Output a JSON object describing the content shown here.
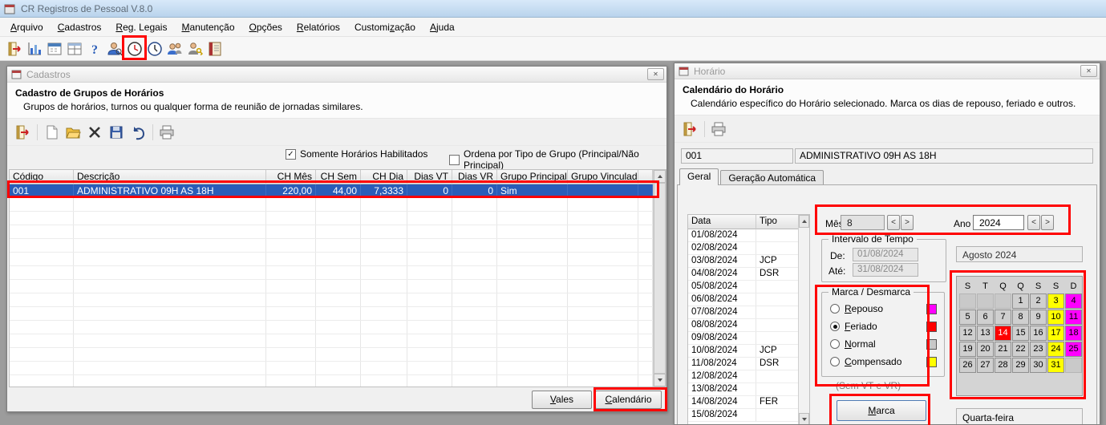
{
  "app": {
    "title": "CR Registros de Pessoal V.8.0"
  },
  "menu": {
    "items": [
      {
        "label": "Arquivo",
        "u": 0
      },
      {
        "label": "Cadastros",
        "u": 0
      },
      {
        "label": "Reg. Legais",
        "u": 0
      },
      {
        "label": "Manutenção",
        "u": 0
      },
      {
        "label": "Opções",
        "u": 0
      },
      {
        "label": "Relatórios",
        "u": 0
      },
      {
        "label": "Customização",
        "u": 7
      },
      {
        "label": "Ajuda",
        "u": 0
      }
    ]
  },
  "main_toolbar": {
    "icons": [
      "exit",
      "chart",
      "calendar",
      "grid",
      "help",
      "user-search",
      "clock-circle",
      "clock",
      "users",
      "user-key",
      "ledger"
    ]
  },
  "cadastros_window": {
    "title": "Cadastros",
    "header": {
      "title": "Cadastro de Grupos de Horários",
      "subtitle": "Grupos de horários, turnos ou qualquer forma de reunião de jornadas similares."
    },
    "toolbar_icons": [
      "exit",
      "sep",
      "new",
      "open",
      "delete",
      "save",
      "undo",
      "sep",
      "print"
    ],
    "checkboxes": [
      {
        "label": "Somente Horários Habilitados",
        "checked": true
      },
      {
        "label": "Ordena por Tipo de Grupo (Principal/Não Principal)",
        "checked": false
      }
    ],
    "grid": {
      "columns": [
        "Código",
        "Descrição",
        "CH Mês",
        "CH Sem",
        "CH Dia",
        "Dias VT",
        "Dias VR",
        "Grupo Principal",
        "Grupo Vinculado"
      ],
      "rows": [
        [
          "001",
          "ADMINISTRATIVO 09H AS 18H",
          "220,00",
          "44,00",
          "7,3333",
          "0",
          "0",
          "Sim",
          ""
        ]
      ],
      "selected_row": 0,
      "empty_rows": 15
    },
    "buttons": [
      {
        "label": "Vales",
        "u": 0
      },
      {
        "label": "Calendário",
        "u": 0
      }
    ]
  },
  "horario_window": {
    "title": "Horário",
    "header": {
      "title": "Calendário do Horário",
      "subtitle": "Calendário específico do Horário selecionado. Marca os dias de repouso, feriado e outros."
    },
    "toolbar_icons": [
      "exit",
      "sep",
      "print"
    ],
    "code_value": "001",
    "name_value": "ADMINISTRATIVO 09H AS 18H",
    "tabs": [
      {
        "label": "Geral",
        "active": true
      },
      {
        "label": "Geração Automática",
        "active": false
      }
    ],
    "date_grid": {
      "columns": [
        "Data",
        "Tipo"
      ],
      "rows": [
        [
          "01/08/2024",
          ""
        ],
        [
          "02/08/2024",
          ""
        ],
        [
          "03/08/2024",
          "JCP"
        ],
        [
          "04/08/2024",
          "DSR"
        ],
        [
          "05/08/2024",
          ""
        ],
        [
          "06/08/2024",
          ""
        ],
        [
          "07/08/2024",
          ""
        ],
        [
          "08/08/2024",
          ""
        ],
        [
          "09/08/2024",
          ""
        ],
        [
          "10/08/2024",
          "JCP"
        ],
        [
          "11/08/2024",
          "DSR"
        ],
        [
          "12/08/2024",
          ""
        ],
        [
          "13/08/2024",
          ""
        ],
        [
          "14/08/2024",
          "FER"
        ],
        [
          "15/08/2024",
          ""
        ]
      ]
    },
    "month_year": {
      "mes_label": "Mês",
      "mes_value": "8",
      "ano_label": "Ano",
      "ano_value": "2024",
      "prev": "<",
      "next": ">"
    },
    "intervalo": {
      "legend": "Intervalo de Tempo",
      "de_label": "De:",
      "de_value": "01/08/2024",
      "ate_label": "Até:",
      "ate_value": "31/08/2024"
    },
    "marca_desmarca": {
      "legend": "Marca / Desmarca",
      "options": [
        {
          "label": "Repouso",
          "u": 0,
          "color": "#ff00ff",
          "selected": false
        },
        {
          "label": "Feriado",
          "u": 0,
          "color": "#ff0000",
          "selected": true
        },
        {
          "label": "Normal",
          "u": 0,
          "color": "#c8c8c8",
          "selected": false
        },
        {
          "label": "Compensado",
          "u": 0,
          "color": "#ffff00",
          "selected": false
        }
      ],
      "note": "(Sem VT e VR)"
    },
    "calendar": {
      "month_label": "Agosto 2024",
      "day_headers": [
        "S",
        "T",
        "Q",
        "Q",
        "S",
        "S",
        "D"
      ],
      "weeks": [
        [
          "",
          "",
          "",
          "1",
          "2",
          "3",
          "4"
        ],
        [
          "5",
          "6",
          "7",
          "8",
          "9",
          "10",
          "11"
        ],
        [
          "12",
          "13",
          "14",
          "15",
          "16",
          "17",
          "18"
        ],
        [
          "19",
          "20",
          "21",
          "22",
          "23",
          "24",
          "25"
        ],
        [
          "26",
          "27",
          "28",
          "29",
          "30",
          "31",
          ""
        ]
      ],
      "day_colors": {
        "3": "#ffff00",
        "4": "#ff00ff",
        "10": "#ffff00",
        "11": "#ff00ff",
        "14": "#ff0000",
        "17": "#ffff00",
        "18": "#ff00ff",
        "24": "#ffff00",
        "25": "#ff00ff",
        "31": "#ffff00"
      }
    },
    "marca_button": {
      "label": "Marca",
      "u": 0
    },
    "weekday_label": "Quarta-feira"
  }
}
